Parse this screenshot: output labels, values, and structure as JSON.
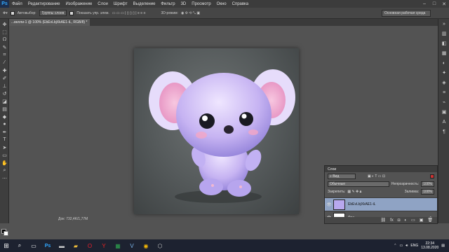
{
  "menubar": {
    "logo": "Ps",
    "items": [
      "Файл",
      "Редактирование",
      "Изображение",
      "Слои",
      "Шрифт",
      "Выделение",
      "Фильтр",
      "3D",
      "Просмотр",
      "Окно",
      "Справка"
    ],
    "controls": [
      "–",
      "□",
      "✕"
    ]
  },
  "options": {
    "auto_select": "Автовыбор:",
    "auto_select_value": "Группы слоев",
    "show_transform": "Показать упр. элем.",
    "mode_3d": "3D-режим:",
    "workspace": "Основная рабочая среда"
  },
  "document": {
    "tab_title": "...велли-1 @ 100% (EbEvLbjXkAE1-iL, RGB/8) *",
    "status": "Док: 732,4K/1,77M"
  },
  "layers_panel": {
    "title": "Слои",
    "kind_filter": "Вид",
    "blend_mode": "Обычные",
    "opacity_label": "Непрозрачность:",
    "opacity_value": "100%",
    "lock_label": "Закрепить:",
    "fill_label": "Заливка:",
    "fill_value": "100%",
    "layers": [
      {
        "name": "EbEvLbjXkAE1-iL",
        "selected": true
      },
      {
        "name": "Фон",
        "selected": false
      }
    ]
  },
  "taskbar": {
    "search_icon": "search-icon",
    "lang": "ENG",
    "time": "22:34",
    "date": "13.08.2020"
  },
  "colors": {
    "accent": "#31a8ff",
    "selected_layer": "#8fa3c4"
  }
}
